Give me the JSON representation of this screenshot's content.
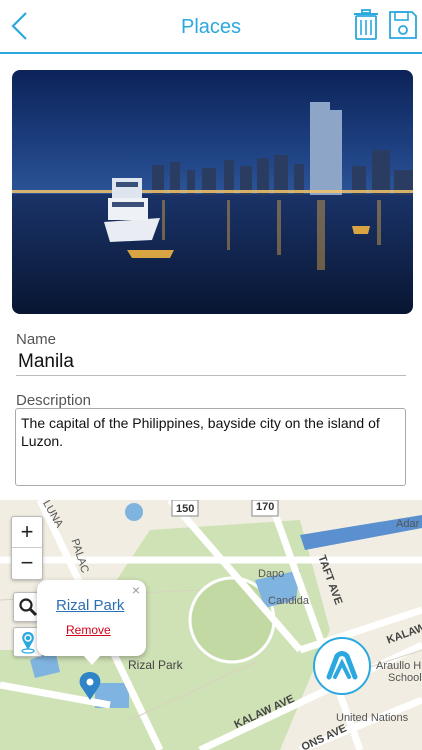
{
  "header": {
    "title": "Places",
    "back_icon": "chevron-left-icon",
    "delete_icon": "trash-icon",
    "save_icon": "floppy-disk-icon",
    "accent_color": "#2aa8df"
  },
  "form": {
    "name_label": "Name",
    "name_value": "Manila",
    "description_label": "Description",
    "description_value": "The capital of the Philippines, bayside city on the island of Luzon."
  },
  "map": {
    "zoom_in_label": "+",
    "zoom_out_label": "−",
    "search_icon": "magnifier-icon",
    "locate_icon": "location-pin-icon",
    "popup": {
      "title": "Rizal Park",
      "remove_label": "Remove",
      "close_label": "×"
    },
    "labels": {
      "route_150": "150",
      "route_170": "170",
      "luna": "LUNA",
      "palacio": "PALAC",
      "dapo": "Dapo",
      "candida": "Candida",
      "taft_ave": "TAFT AVE",
      "kalaw_top": "KALAW",
      "adar": "Adar",
      "araullo": "Araullo H",
      "school": "School",
      "rizal_park": "Rizal Park",
      "kalaw_ave": "KALAW AVE",
      "ons_ave": "ONS AVE",
      "united_nations": "United Nations"
    }
  }
}
